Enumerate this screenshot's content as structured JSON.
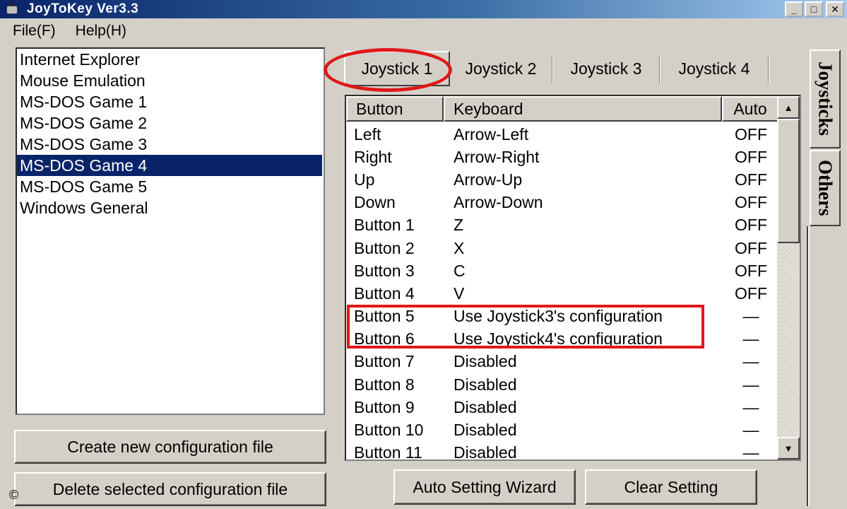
{
  "window": {
    "title": "JoyToKey Ver3.3",
    "minimize_glyph": "_",
    "maximize_glyph": "□",
    "close_glyph": "✕"
  },
  "menu": {
    "file": "File(F)",
    "help": "Help(H)"
  },
  "config_list": {
    "items": [
      "Internet Explorer",
      "Mouse Emulation",
      "MS-DOS Game 1",
      "MS-DOS Game 2",
      "MS-DOS Game 3",
      "MS-DOS Game 4",
      "MS-DOS Game 5",
      "Windows General"
    ],
    "selected": "MS-DOS Game 4"
  },
  "buttons": {
    "create": "Create new configuration file",
    "delete": "Delete selected configuration file",
    "wizard": "Auto Setting Wizard",
    "clear": "Clear Setting"
  },
  "copyright_glyph": "©",
  "tabs": [
    "Joystick 1",
    "Joystick 2",
    "Joystick 3",
    "Joystick 4"
  ],
  "active_tab": "Joystick 1",
  "table": {
    "headers": [
      "Button",
      "Keyboard",
      "Auto"
    ],
    "rows": [
      [
        "Left",
        "Arrow-Left",
        "OFF"
      ],
      [
        "Right",
        "Arrow-Right",
        "OFF"
      ],
      [
        "Up",
        "Arrow-Up",
        "OFF"
      ],
      [
        "Down",
        "Arrow-Down",
        "OFF"
      ],
      [
        "Button 1",
        "Z",
        "OFF"
      ],
      [
        "Button 2",
        "X",
        "OFF"
      ],
      [
        "Button 3",
        "C",
        "OFF"
      ],
      [
        "Button 4",
        "V",
        "OFF"
      ],
      [
        "Button 5",
        "Use Joystick3's configuration",
        "—"
      ],
      [
        "Button 6",
        "Use Joystick4's configuration",
        "—"
      ],
      [
        "Button 7",
        "Disabled",
        "—"
      ],
      [
        "Button 8",
        "Disabled",
        "—"
      ],
      [
        "Button 9",
        "Disabled",
        "—"
      ],
      [
        "Button 10",
        "Disabled",
        "—"
      ],
      [
        "Button 11",
        "Disabled",
        "—"
      ]
    ],
    "scroll_up_glyph": "▲",
    "scroll_down_glyph": "▼"
  },
  "side_tabs": [
    "Joysticks",
    "Others"
  ],
  "colors": {
    "annotation": "#e01818",
    "selection": "#0a246a"
  }
}
